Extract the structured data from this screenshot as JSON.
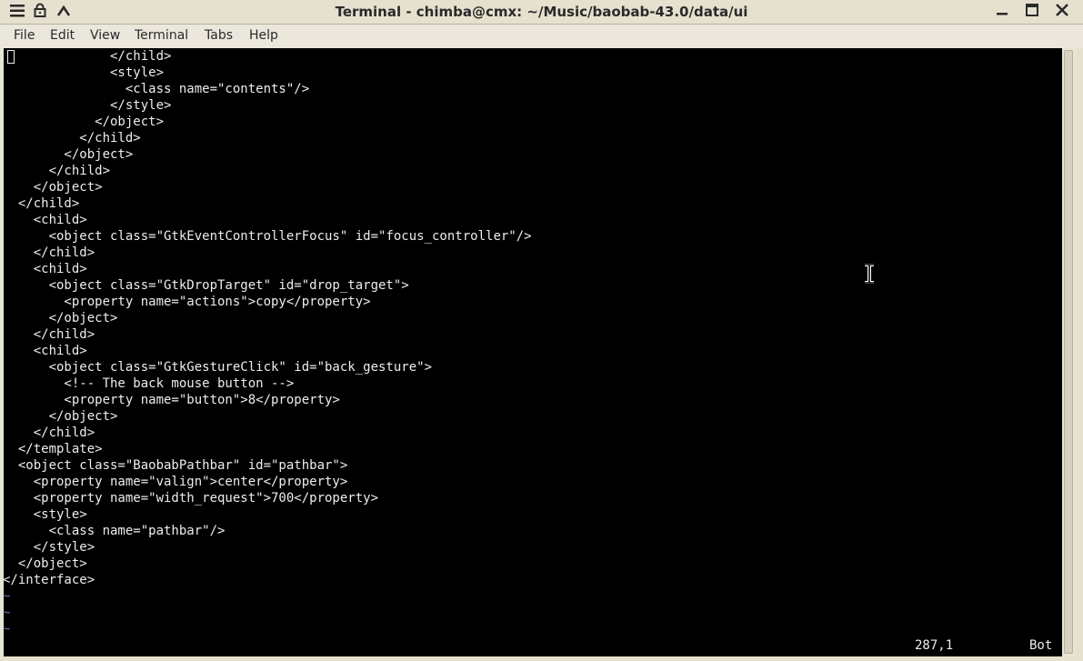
{
  "window": {
    "title": "Terminal - chimba@cmx: ~/Music/baobab-43.0/data/ui"
  },
  "titlebar_buttons": {
    "left": [
      "menu-icon",
      "lock-icon",
      "up-arrow-icon"
    ],
    "right": [
      "minimize-icon",
      "maximize-icon",
      "close-icon"
    ]
  },
  "menu": {
    "file": "File",
    "edit": "Edit",
    "view": "View",
    "terminal": "Terminal",
    "tabs": "Tabs",
    "help": "Help"
  },
  "terminal": {
    "lines": [
      "              </child>",
      "              <style>",
      "                <class name=\"contents\"/>",
      "              </style>",
      "            </object>",
      "          </child>",
      "        </object>",
      "      </child>",
      "    </object>",
      "  </child>",
      "    <child>",
      "      <object class=\"GtkEventControllerFocus\" id=\"focus_controller\"/>",
      "    </child>",
      "    <child>",
      "      <object class=\"GtkDropTarget\" id=\"drop_target\">",
      "        <property name=\"actions\">copy</property>",
      "      </object>",
      "    </child>",
      "    <child>",
      "      <object class=\"GtkGestureClick\" id=\"back_gesture\">",
      "        <!-- The back mouse button -->",
      "        <property name=\"button\">8</property>",
      "      </object>",
      "    </child>",
      "  </template>",
      "  <object class=\"BaobabPathbar\" id=\"pathbar\">",
      "    <property name=\"valign\">center</property>",
      "    <property name=\"width_request\">700</property>",
      "    <style>",
      "      <class name=\"pathbar\"/>",
      "    </style>",
      "  </object>",
      "</interface>"
    ],
    "tildes": [
      "~",
      "~",
      "~"
    ],
    "status_position": "287,1",
    "status_scroll": "Bot"
  }
}
